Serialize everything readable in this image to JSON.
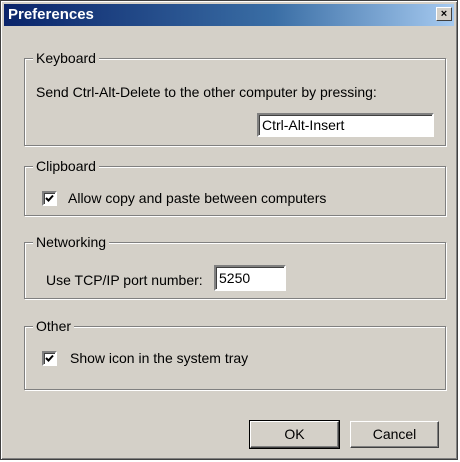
{
  "window": {
    "title": "Preferences",
    "close_glyph": "×"
  },
  "keyboard": {
    "legend": "Keyboard",
    "description": "Send Ctrl-Alt-Delete to the other computer by pressing:",
    "shortcut_value": "Ctrl-Alt-Insert"
  },
  "clipboard": {
    "legend": "Clipboard",
    "checkbox_label": "Allow copy and paste between computers",
    "checked": true
  },
  "networking": {
    "legend": "Networking",
    "port_label": "Use TCP/IP port number:",
    "port_value": "5250"
  },
  "other": {
    "legend": "Other",
    "checkbox_label": "Show icon in the system tray",
    "checked": true
  },
  "buttons": {
    "ok_label": "OK",
    "cancel_label": "Cancel"
  }
}
